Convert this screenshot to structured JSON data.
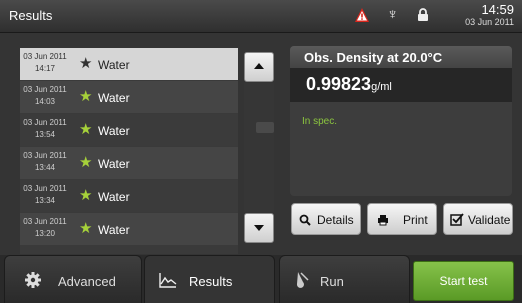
{
  "header": {
    "title": "Results",
    "time": "14:59",
    "date": "03 Jun 2011",
    "icons": [
      "warning-icon",
      "usb-icon",
      "lock-icon"
    ],
    "warning_color": "#d9261c"
  },
  "results": {
    "rows": [
      {
        "date": "03 Jun 2011",
        "time": "14:17",
        "name": "Water",
        "selected": true
      },
      {
        "date": "03 Jun 2011",
        "time": "14:03",
        "name": "Water",
        "selected": false
      },
      {
        "date": "03 Jun 2011",
        "time": "13:54",
        "name": "Water",
        "selected": false
      },
      {
        "date": "03 Jun 2011",
        "time": "13:44",
        "name": "Water",
        "selected": false
      },
      {
        "date": "03 Jun 2011",
        "time": "13:34",
        "name": "Water",
        "selected": false
      },
      {
        "date": "03 Jun 2011",
        "time": "13:20",
        "name": "Water",
        "selected": false
      }
    ],
    "star_color": "#a6d13a"
  },
  "measurement": {
    "title": "Obs. Density at  20.0°C",
    "value": "0.99823",
    "unit": "g/ml",
    "status": "In spec.",
    "status_color": "#8cc63f"
  },
  "actions": {
    "details_label": "Details",
    "print_label": "Print",
    "validate_label": "Validate"
  },
  "tabs": {
    "advanced_label": "Advanced",
    "results_label": "Results",
    "run_label": "Run",
    "start_label": "Start test",
    "start_color": "#6fae35"
  }
}
